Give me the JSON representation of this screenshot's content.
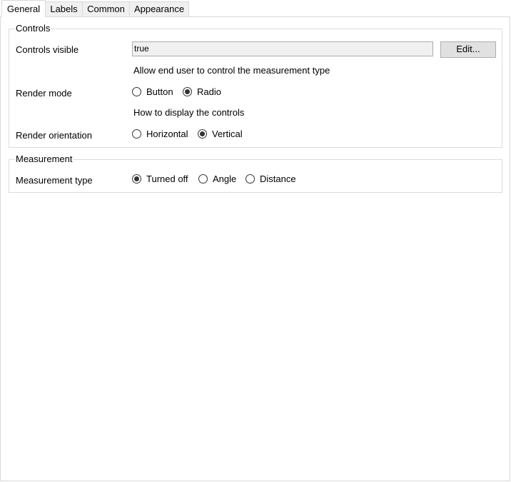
{
  "tabs": [
    {
      "label": "General",
      "active": true
    },
    {
      "label": "Labels",
      "active": false
    },
    {
      "label": "Common",
      "active": false
    },
    {
      "label": "Appearance",
      "active": false
    }
  ],
  "controls_group": {
    "title": "Controls",
    "controls_visible": {
      "label": "Controls visible",
      "value": "true",
      "edit_button": "Edit...",
      "hint": "Allow end user to control the measurement type"
    },
    "render_mode": {
      "label": "Render mode",
      "options": [
        {
          "label": "Button",
          "checked": false
        },
        {
          "label": "Radio",
          "checked": true
        }
      ],
      "hint": "How to display the controls"
    },
    "render_orientation": {
      "label": "Render orientation",
      "options": [
        {
          "label": "Horizontal",
          "checked": false
        },
        {
          "label": "Vertical",
          "checked": true
        }
      ]
    }
  },
  "measurement_group": {
    "title": "Measurement",
    "measurement_type": {
      "label": "Measurement type",
      "options": [
        {
          "label": "Turned off",
          "checked": true
        },
        {
          "label": "Angle",
          "checked": false
        },
        {
          "label": "Distance",
          "checked": false
        }
      ]
    }
  }
}
